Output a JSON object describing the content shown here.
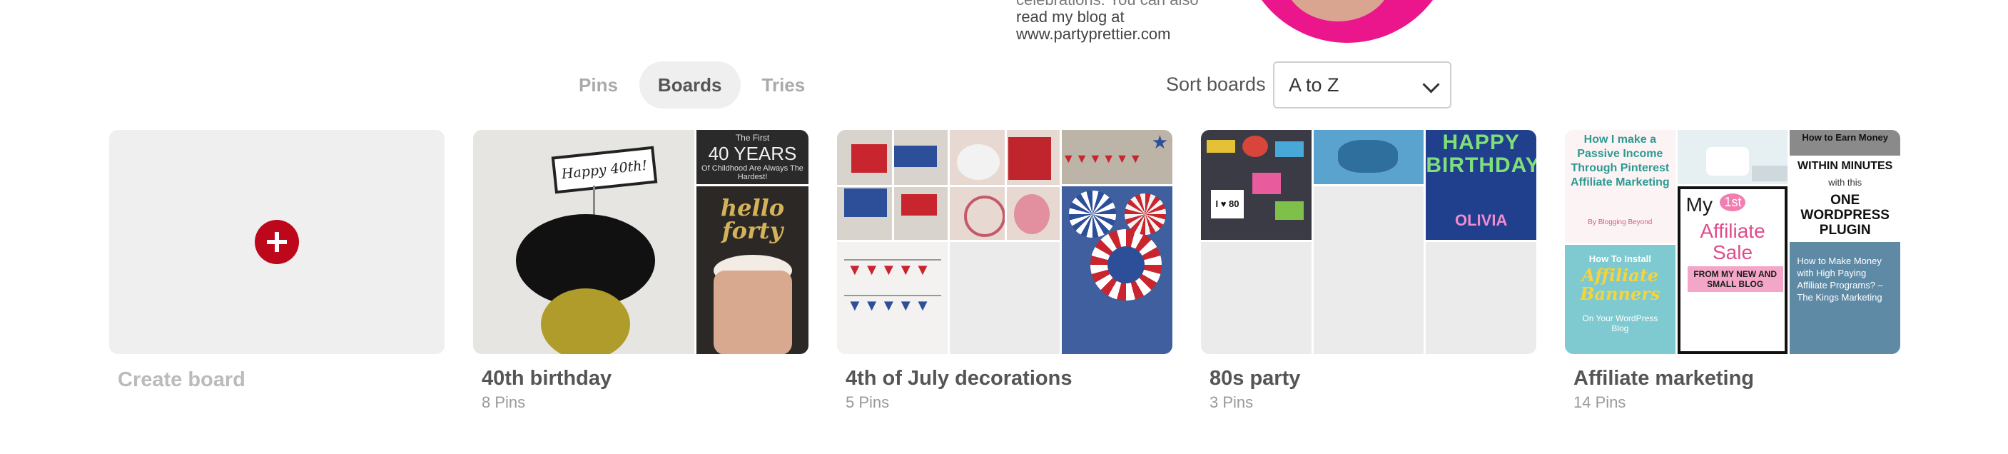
{
  "profile": {
    "bio_cut": "celebrations. You can also",
    "bio_lines": [
      "read my blog at",
      "www.partyprettier.com"
    ]
  },
  "tabs": [
    {
      "label": "Pins",
      "active": false
    },
    {
      "label": "Boards",
      "active": true
    },
    {
      "label": "Tries",
      "active": false
    }
  ],
  "sort": {
    "label": "Sort boards",
    "value": "A to Z"
  },
  "create_board": {
    "label": "Create board"
  },
  "boards": [
    {
      "title": "40th birthday",
      "count": "8",
      "count_unit": "Pins",
      "cover_text": {
        "years": "40 YEARS",
        "years_top": "The First",
        "years_sub": "Of Childhood Are Always The Hardest!",
        "topper": "Happy 40th!",
        "hello": "hello forty"
      }
    },
    {
      "title": "4th of July decorations",
      "count": "5",
      "count_unit": "Pins"
    },
    {
      "title": "80s party",
      "count": "3",
      "count_unit": "Pins",
      "cover_text": {
        "sign1": "I ♥ 80",
        "banner": "HAPPY BIRTHDAY",
        "name": "OLIVIA"
      }
    },
    {
      "title": "Affiliate marketing",
      "count": "14",
      "count_unit": "Pins",
      "cover_text": {
        "p1": "How I make a Passive Income Through Pinterest Affiliate Marketing",
        "p1b": "By Blogging Beyond",
        "p2a": "How To Install",
        "p2b": "Affiliate Banners",
        "p2c": "On Your WordPress Blog",
        "p3a": "My",
        "p3b": "1st",
        "p3c": "Affiliate Sale",
        "p3d": "FROM MY NEW AND SMALL BLOG",
        "p4a": "How to Earn Money",
        "p4b": "WITHIN MINUTES",
        "p4c": "with this",
        "p4d": "ONE WORDPRESS PLUGIN",
        "p5": "How to Make Money with High Paying Affiliate Programs? – The Kings Marketing"
      }
    }
  ],
  "colors": {
    "accent": "#bd081c",
    "tab_active_bg": "#efefef"
  }
}
